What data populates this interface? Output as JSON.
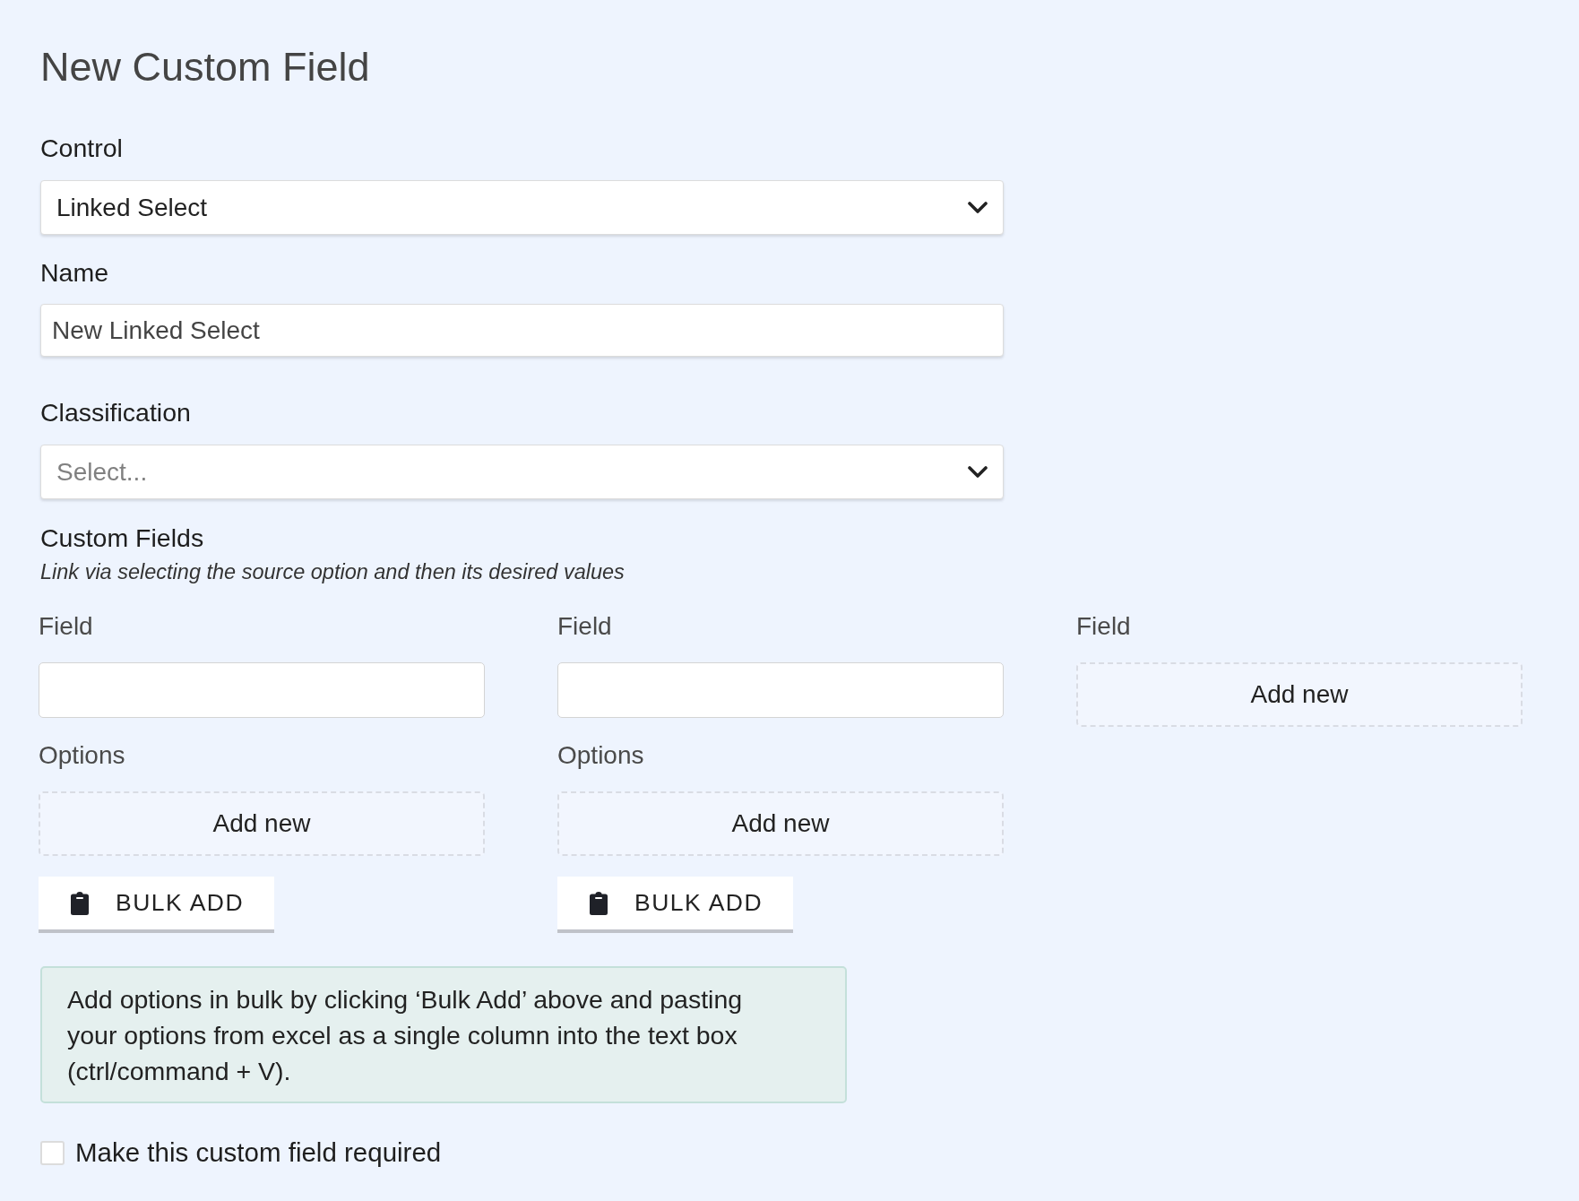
{
  "page": {
    "title": "New Custom Field"
  },
  "control": {
    "label": "Control",
    "value": "Linked Select"
  },
  "name": {
    "label": "Name",
    "value": "New Linked Select"
  },
  "classification": {
    "label": "Classification",
    "placeholder": "Select..."
  },
  "custom_fields": {
    "heading": "Custom Fields",
    "hint": "Link via selecting the source option and then its desired values",
    "columns": [
      {
        "kind": "field",
        "field_label": "Field",
        "options_label": "Options",
        "add_new": "Add new",
        "bulk_add": "BULK ADD"
      },
      {
        "kind": "field",
        "field_label": "Field",
        "options_label": "Options",
        "add_new": "Add new",
        "bulk_add": "BULK ADD"
      },
      {
        "kind": "add",
        "field_label": "Field",
        "add_new": "Add new"
      }
    ]
  },
  "info": "Add options in bulk by clicking ‘Bulk Add’ above and pasting your options from excel as a single column into the text box (ctrl/command + V).",
  "required": {
    "label": "Make this custom field required",
    "checked": false
  }
}
